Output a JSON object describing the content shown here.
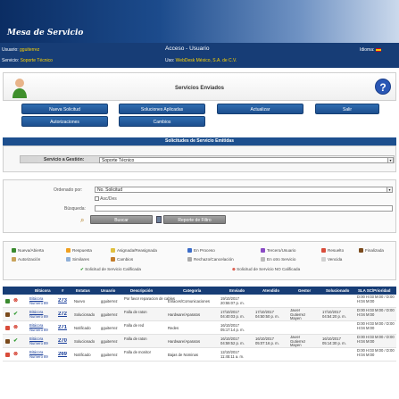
{
  "app": {
    "title": "Mesa de Servicio"
  },
  "topbar": {
    "user_label": "Usuario:",
    "user_value": "gguiterrez",
    "access": "Acceso - Usuario",
    "language_label": "Idioma:",
    "service_label": "Servicio:",
    "service_value": "Soporte Técnico",
    "use_label": "Uso:",
    "use_value": "WebDesk México, S.A. de C.V."
  },
  "header": {
    "title": "Servicios Enviados"
  },
  "actions": {
    "nueva": "Nueva Solicitud",
    "soluciones": "Soluciones Aplicadas",
    "actualizar": "Actualizar",
    "salir": "Salir",
    "autorizaciones": "Autorizaciones",
    "cambios": "Cambios"
  },
  "section": {
    "title": "Solicitudes de Servicio Emitidas",
    "gestion_label": "Servicio a Gestión:",
    "gestion_value": "Soporte Técnico"
  },
  "filters": {
    "ordenado_label": "Ordenado por:",
    "ordenado_value": "No. Solicitud",
    "ascdes": "Asc/Des",
    "busqueda_label": "Búsqueda:",
    "buscar": "Buscar",
    "reporte": "Reporte de Filtro"
  },
  "legend": {
    "row1": [
      "Nueva/Abierta",
      "Respuesta",
      "Asignada/Reasignada",
      "En Proceso",
      "Tercero/Usuario",
      "Resuelto",
      "Finalizada"
    ],
    "row2": [
      "Autorización",
      "Similares",
      "Cambios",
      "Rechazo/Cancelación",
      "En otro Servicio",
      "Vencida"
    ],
    "row3a": "Solicitud de Servicio Calificada",
    "row3b": "Solicitud de Servicio NO Calificada",
    "colors": [
      "#3a8a2f",
      "#f0a020",
      "#e0c040",
      "#3b6cc9",
      "#8a4bc4",
      "#d94c3a",
      "#7a4a1c"
    ]
  },
  "table": {
    "headers": [
      "Bitácora",
      "#",
      "Estatus",
      "Usuario",
      "Descripción",
      "Categoría",
      "Enviado",
      "Atendido",
      "Gestor",
      "Solucionado",
      "SLA SC/Prioridad"
    ],
    "rows": [
      {
        "bit": "Bitácora Numero 89",
        "num": "273",
        "estatus": "Nuevo",
        "usuario": "gguiterrez",
        "desc": "Por favor reparacion de cables",
        "cat": "Enlaces/Comunicaciones",
        "env": "19/10/2017 20:55:07 p. m.",
        "at": "",
        "gestor": "",
        "sol": "",
        "sla": "D:00 H:03 M:00 / D:00 H:04 M:00"
      },
      {
        "bit": "Bitácora Numero 89",
        "num": "272",
        "estatus": "Solucionado",
        "usuario": "gguiterrez",
        "desc": "Falla de raton",
        "cat": "Hardware/Aparatos",
        "env": "17/10/2017 04:40:03 p. m.",
        "at": "17/10/2017 04:50:50 p. m.",
        "gestor": "Javier Gutierrez Mayen",
        "sol": "17/10/2017 04:54:20 p. m.",
        "sla": "D:00 H:03 M:00 / D:00 H:04 M:00"
      },
      {
        "bit": "Bitácora Numero 89",
        "num": "271",
        "estatus": "Notificado",
        "usuario": "gguiterrez",
        "desc": "Falla de red",
        "cat": "Redes",
        "env": "16/10/2017 05:17:14 p. m.",
        "at": "",
        "gestor": "",
        "sol": "",
        "sla": "D:00 H:03 M:00 / D:00 H:04 M:00"
      },
      {
        "bit": "Bitácora Numero 89",
        "num": "270",
        "estatus": "Solucionado",
        "usuario": "gguiterrez",
        "desc": "Falla de raton",
        "cat": "Hardware/Aparatos",
        "env": "16/10/2017 04:59:52 p. m.",
        "at": "16/10/2017 05:07:16 p. m.",
        "gestor": "Javier Gutierrez Mayen",
        "sol": "16/10/2017 05:14:30 p. m.",
        "sla": "D:00 H:03 M:00 / D:00 H:04 M:00"
      },
      {
        "bit": "Bitácora Numero 89",
        "num": "269",
        "estatus": "Notificado",
        "usuario": "gguiterrez",
        "desc": "Falla de monitor",
        "cat": "Bajas de Nominas",
        "env": "12/10/2017 11:45:11 a. m.",
        "at": "",
        "gestor": "",
        "sol": "",
        "sla": "D:00 H:03 M:00 / D:00 H:04 M:00"
      }
    ]
  }
}
